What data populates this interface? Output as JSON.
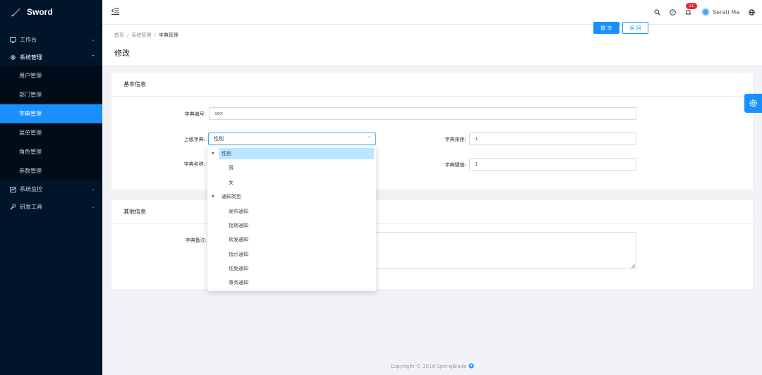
{
  "app": {
    "name": "Sword"
  },
  "sidebar": {
    "items": [
      {
        "label": "工作台",
        "icon": "monitor-icon"
      },
      {
        "label": "系统管理",
        "icon": "gear-icon"
      },
      {
        "label": "系统监控",
        "icon": "chart-icon"
      },
      {
        "label": "研发工具",
        "icon": "wrench-icon"
      }
    ],
    "sub_items": [
      {
        "label": "用户管理"
      },
      {
        "label": "部门管理"
      },
      {
        "label": "字典管理"
      },
      {
        "label": "菜单管理"
      },
      {
        "label": "角色管理"
      },
      {
        "label": "参数管理"
      }
    ]
  },
  "header": {
    "notification_count": "11",
    "user_name": "Serati Ma"
  },
  "breadcrumb": [
    "首页",
    "系统管理",
    "字典管理"
  ],
  "page": {
    "title": "修改",
    "submit_label": "提 交",
    "back_label": "返 回"
  },
  "basic_info": {
    "title": "基本信息",
    "code_label": "字典编号:",
    "code_value": "sex",
    "parent_label": "上级字典:",
    "parent_value": "性别",
    "name_label": "字典名称:",
    "sort_label": "字典排序:",
    "sort_value": "1",
    "key_label": "字典键值:",
    "key_value": "1"
  },
  "other_info": {
    "title": "其他信息",
    "remark_label": "字典备注:"
  },
  "dropdown": {
    "nodes": [
      {
        "label": "性别",
        "level": 0,
        "selected": true
      },
      {
        "label": "男",
        "level": 1
      },
      {
        "label": "女",
        "level": 1
      },
      {
        "label": "通知类型",
        "level": 0
      },
      {
        "label": "发布通知",
        "level": 1
      },
      {
        "label": "批转通知",
        "level": 1
      },
      {
        "label": "转发通知",
        "level": 1
      },
      {
        "label": "指示通知",
        "level": 1
      },
      {
        "label": "任免通知",
        "level": 1
      },
      {
        "label": "事务通知",
        "level": 1
      }
    ]
  },
  "footer": {
    "text": "Copyright © 2018 SpringBlade"
  },
  "colors": {
    "primary": "#1890ff",
    "sidebar_bg": "#001529",
    "badge": "#f5222d"
  }
}
